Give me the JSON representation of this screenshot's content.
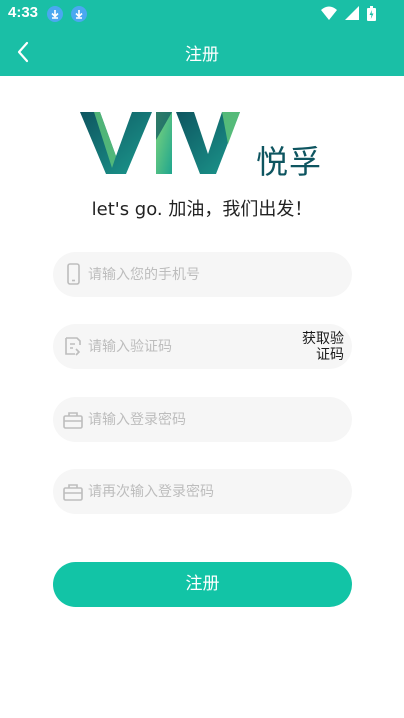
{
  "status_bar": {
    "time": "4:33",
    "icons": [
      "download-icon",
      "download-icon",
      "wifi-icon",
      "signal-icon",
      "battery-icon"
    ]
  },
  "header": {
    "title": "注册",
    "back_icon": "chevron-left-icon"
  },
  "logo": {
    "text_cn": "悦孚",
    "colors": {
      "teal_dark": "#0E5560",
      "teal": "#1C9A8E",
      "green": "#5CC27A"
    }
  },
  "slogan": "let's go. 加油，我们出发！",
  "form": {
    "phone": {
      "placeholder": "请输入您的手机号",
      "icon": "phone-icon"
    },
    "code": {
      "placeholder": "请输入验证码",
      "icon": "verify-icon",
      "get_code_label": "获取验证码"
    },
    "password": {
      "placeholder": "请输入登录密码",
      "icon": "lock-icon"
    },
    "confirm_password": {
      "placeholder": "请再次输入登录密码",
      "icon": "lock-icon"
    }
  },
  "submit_label": "注册",
  "colors": {
    "accent": "#1ABFA6",
    "field_bg": "#F6F6F6",
    "placeholder": "#BDBDBD"
  }
}
